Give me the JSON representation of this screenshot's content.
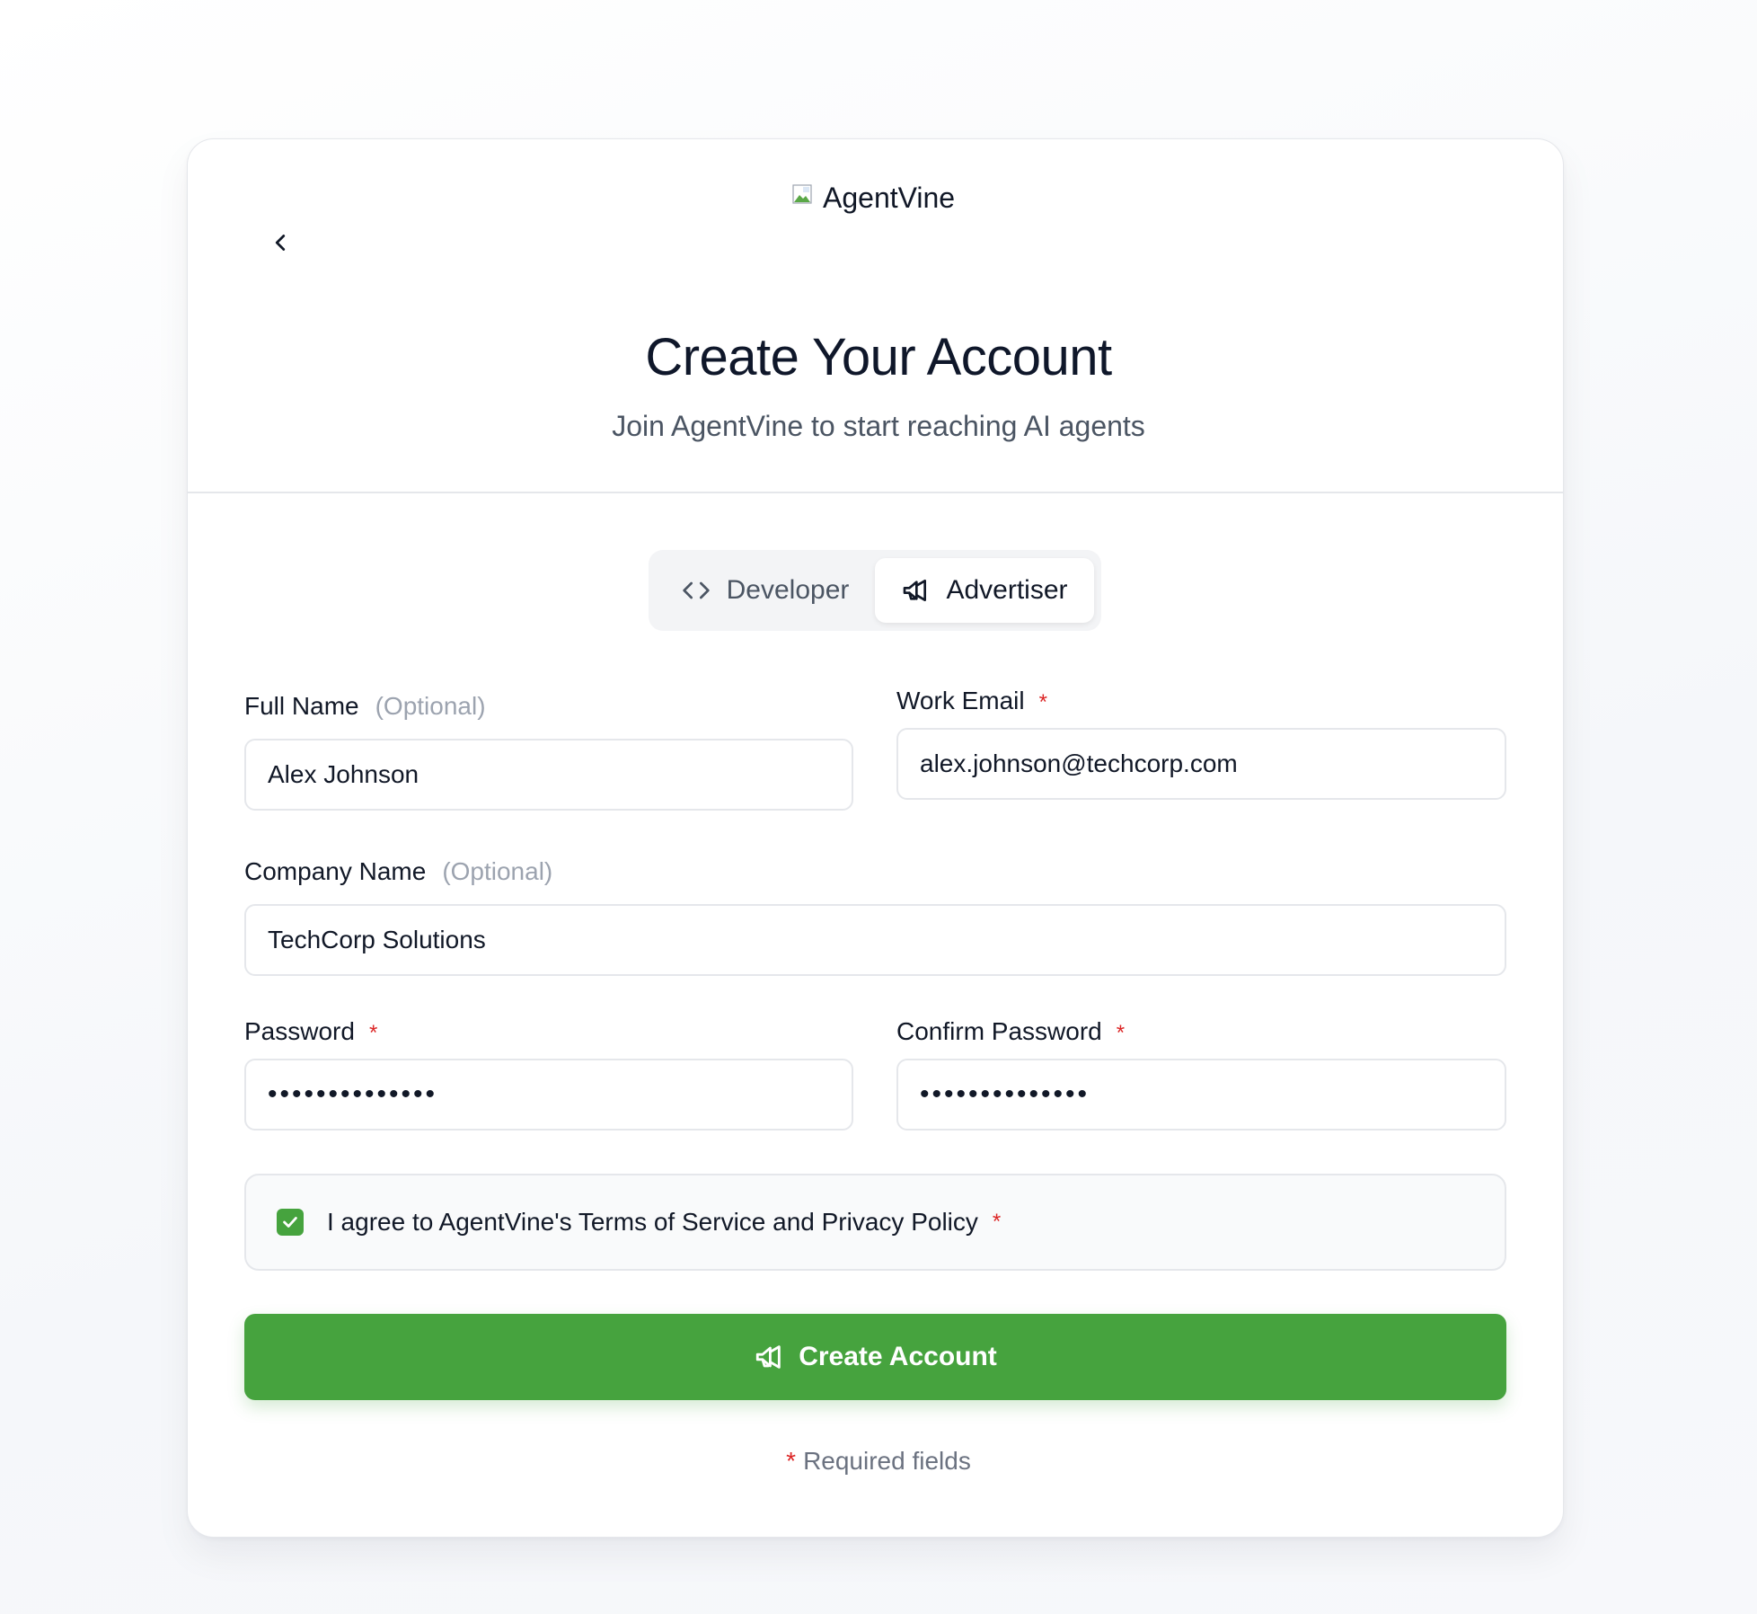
{
  "logo": {
    "alt_text": "AgentVine"
  },
  "header": {
    "title": "Create Your Account",
    "subtitle": "Join AgentVine to start reaching AI agents"
  },
  "account_type": {
    "options": [
      {
        "label": "Developer",
        "icon": "code-icon",
        "selected": false
      },
      {
        "label": "Advertiser",
        "icon": "megaphone-icon",
        "selected": true
      }
    ]
  },
  "form": {
    "full_name": {
      "label": "Full Name",
      "hint": "(Optional)",
      "value": "Alex Johnson"
    },
    "work_email": {
      "label": "Work Email",
      "required_mark": "*",
      "value": "alex.johnson@techcorp.com"
    },
    "company_name": {
      "label": "Company Name",
      "hint": "(Optional)",
      "value": "TechCorp Solutions"
    },
    "password": {
      "label": "Password",
      "required_mark": "*",
      "value": "••••••••••••••"
    },
    "confirm_password": {
      "label": "Confirm Password",
      "required_mark": "*",
      "value": "••••••••••••••"
    },
    "terms": {
      "label": "I agree to AgentVine's Terms of Service and Privacy Policy",
      "required_mark": "*",
      "checked": true
    },
    "submit_label": "Create Account"
  },
  "footnote": {
    "mark": "*",
    "text": "Required fields"
  },
  "colors": {
    "accent": "#46a33e",
    "required": "#dc2626",
    "muted": "#9ca3af",
    "border": "#e5e7eb"
  }
}
